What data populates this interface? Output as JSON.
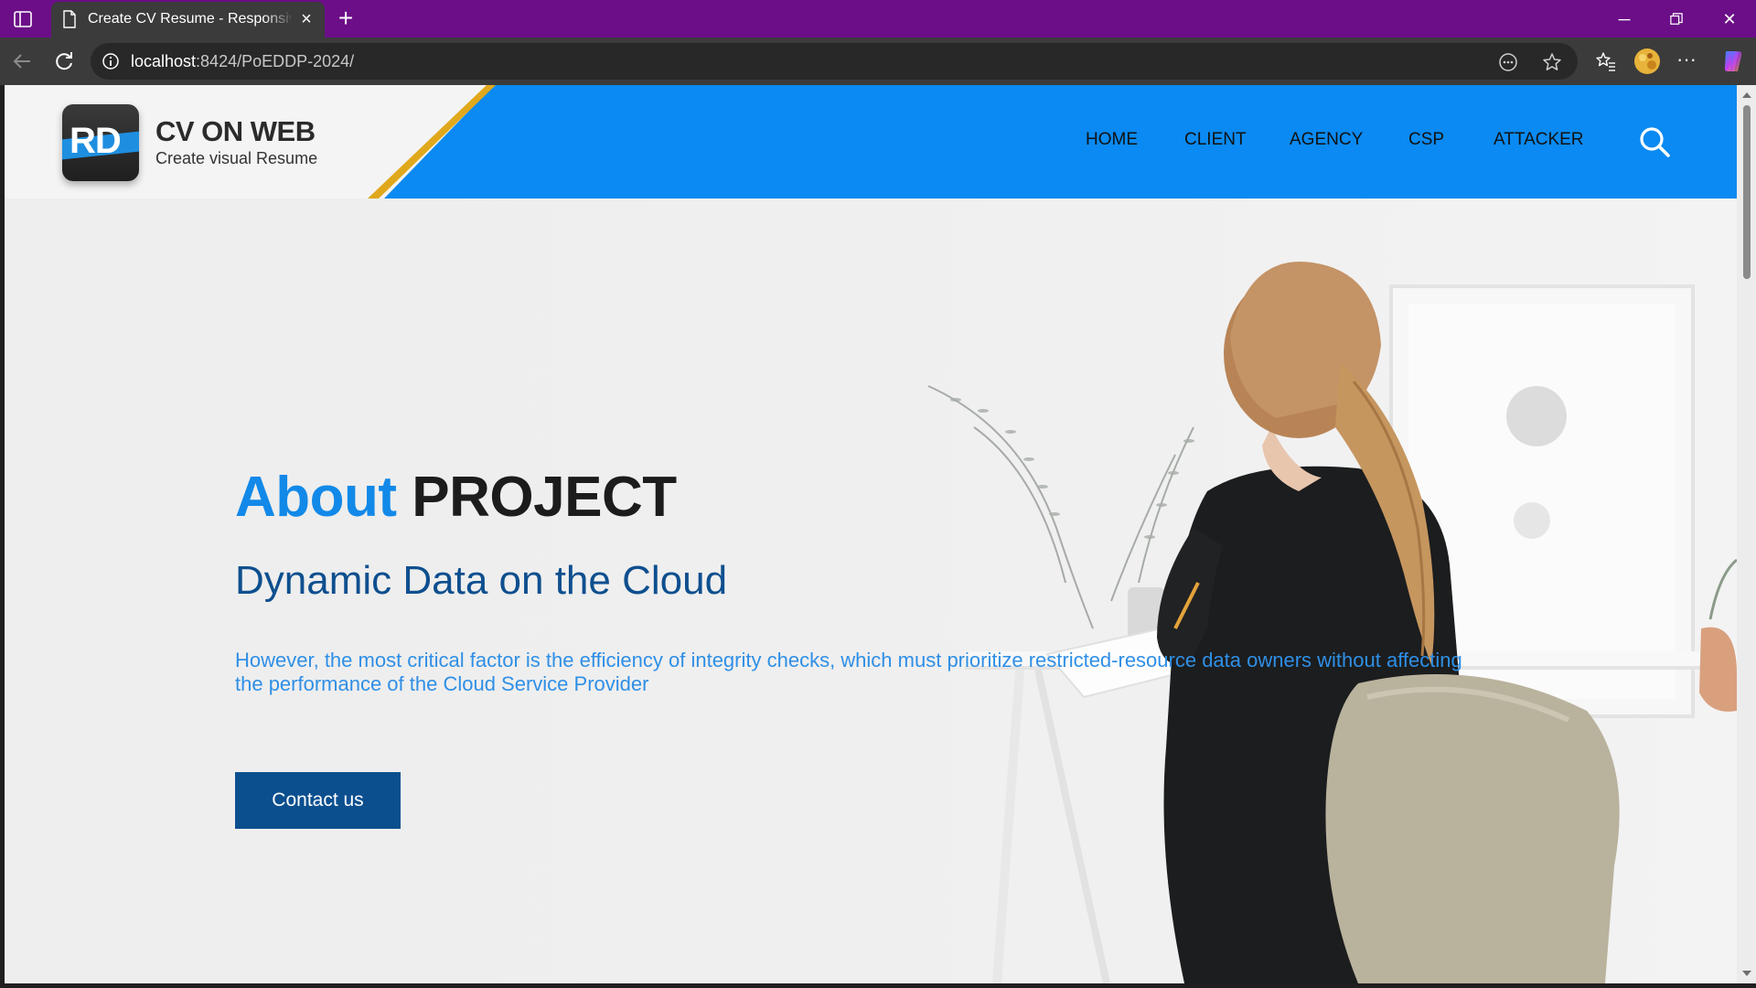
{
  "browser": {
    "tab_title": "Create CV Resume - Responsive HTML",
    "url_host": "localhost",
    "url_rest": ":8424/PoEDDP-2024/",
    "colors": {
      "titlebar": "#6b0e87",
      "toolbar": "#3b3b3b"
    }
  },
  "header": {
    "logo_letters": "RD",
    "brand_name": "CV ON WEB",
    "tagline": "Create visual Resume",
    "nav": {
      "home": "HOME",
      "client": "CLIENT",
      "agency": "AGENCY",
      "csp": "CSP",
      "attacker": "ATTACKER"
    },
    "colors": {
      "band": "#0a8af2",
      "stripe": "#e0a81c"
    }
  },
  "hero": {
    "title_accent": "About",
    "title_rest": "PROJECT",
    "subtitle": "Dynamic Data on the Cloud",
    "text": "However, the most critical factor is the efficiency of integrity checks, which must prioritize restricted-resource data owners without affecting the performance of the Cloud Service Provider",
    "button_label": "Contact us",
    "colors": {
      "accent": "#1289e8",
      "subtitle": "#0e4f8f",
      "button": "#0b4f8f"
    }
  }
}
